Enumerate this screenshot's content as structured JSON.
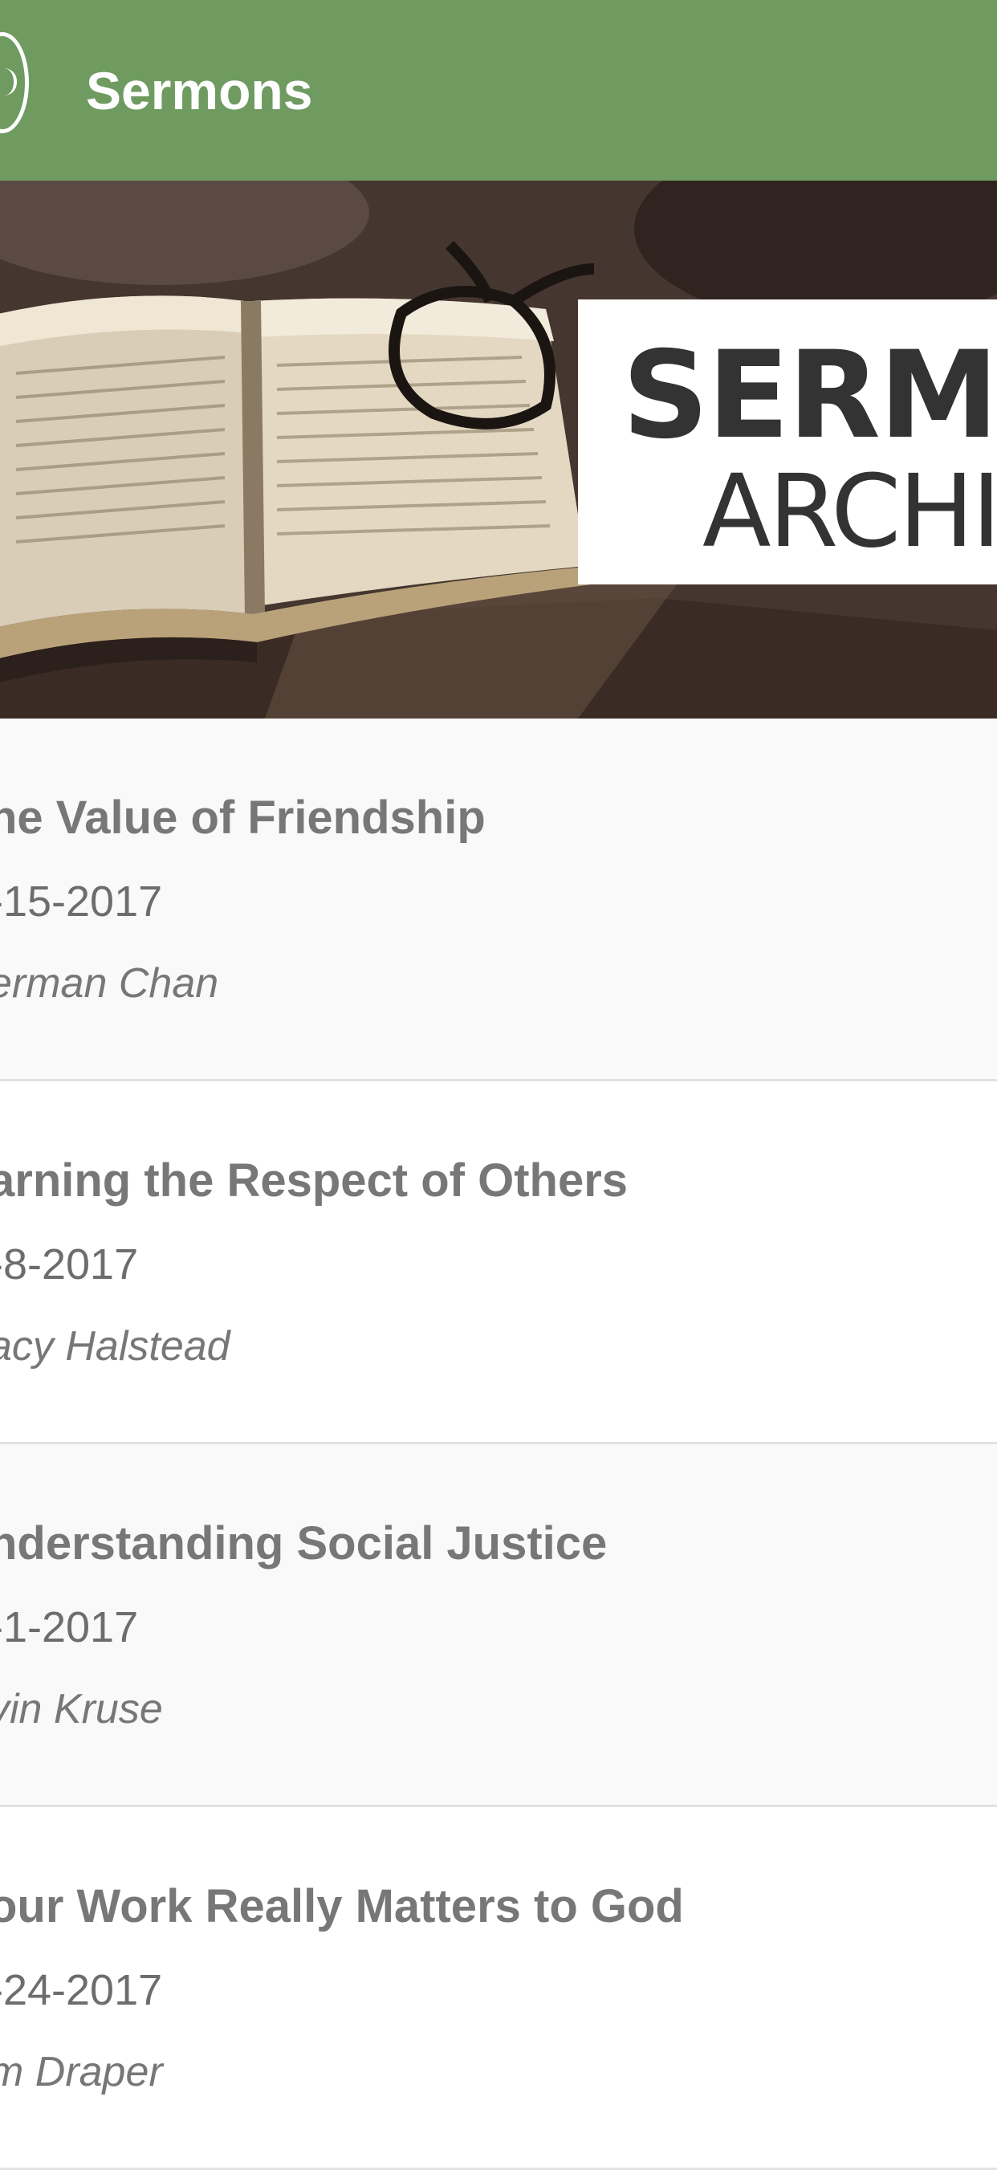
{
  "app_bar": {
    "title": "Sermons",
    "background_color": "#6f9b61",
    "menu_icon": "menu-icon"
  },
  "hero": {
    "line1": "SERM",
    "line2": "ARCHI",
    "image_description_icon": "bible-and-glasses-photo"
  },
  "sermons": [
    {
      "title": "he Value of Friendship",
      "date": "-15-2017",
      "speaker": "erman Chan"
    },
    {
      "title": "arning the Respect of Others",
      "date": "-8-2017",
      "speaker": "acy Halstead"
    },
    {
      "title": "nderstanding Social Justice",
      "date": "-1-2017",
      "speaker": "vin Kruse"
    },
    {
      "title": "our Work Really Matters to God",
      "date": "-24-2017",
      "speaker": "m Draper"
    }
  ]
}
